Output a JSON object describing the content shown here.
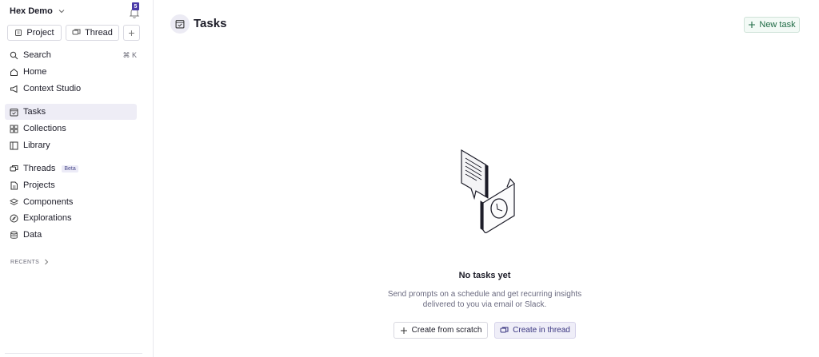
{
  "workspace": {
    "name": "Hex Demo",
    "notifications_count": "5"
  },
  "sidebar": {
    "project_button": "Project",
    "thread_button": "Thread",
    "plus_button": "+",
    "search": {
      "label": "Search",
      "shortcut": "⌘ K"
    },
    "items": [
      {
        "label": "Home",
        "icon": "home-icon"
      },
      {
        "label": "Context Studio",
        "icon": "megaphone-icon"
      },
      {
        "label": "Tasks",
        "icon": "calendar-check-icon",
        "active": true
      },
      {
        "label": "Collections",
        "icon": "grid-icon"
      },
      {
        "label": "Library",
        "icon": "book-icon"
      },
      {
        "label": "Threads",
        "icon": "threads-icon",
        "badge": "Beta"
      },
      {
        "label": "Projects",
        "icon": "document-icon"
      },
      {
        "label": "Components",
        "icon": "layers-icon"
      },
      {
        "label": "Explorations",
        "icon": "compass-icon"
      },
      {
        "label": "Data",
        "icon": "database-icon"
      }
    ],
    "recents_label": "RECENTS"
  },
  "main": {
    "title": "Tasks",
    "new_task_button": "New task",
    "empty": {
      "title": "No tasks yet",
      "description_line1": "Send prompts on a schedule and get recurring insights",
      "description_line2": "delivered to you via email or Slack.",
      "create_scratch": "Create from scratch",
      "create_thread": "Create in thread"
    }
  },
  "colors": {
    "accent": "#4a3aa8",
    "active_bg": "#eeedf6",
    "new_task_text": "#1f6b45"
  }
}
